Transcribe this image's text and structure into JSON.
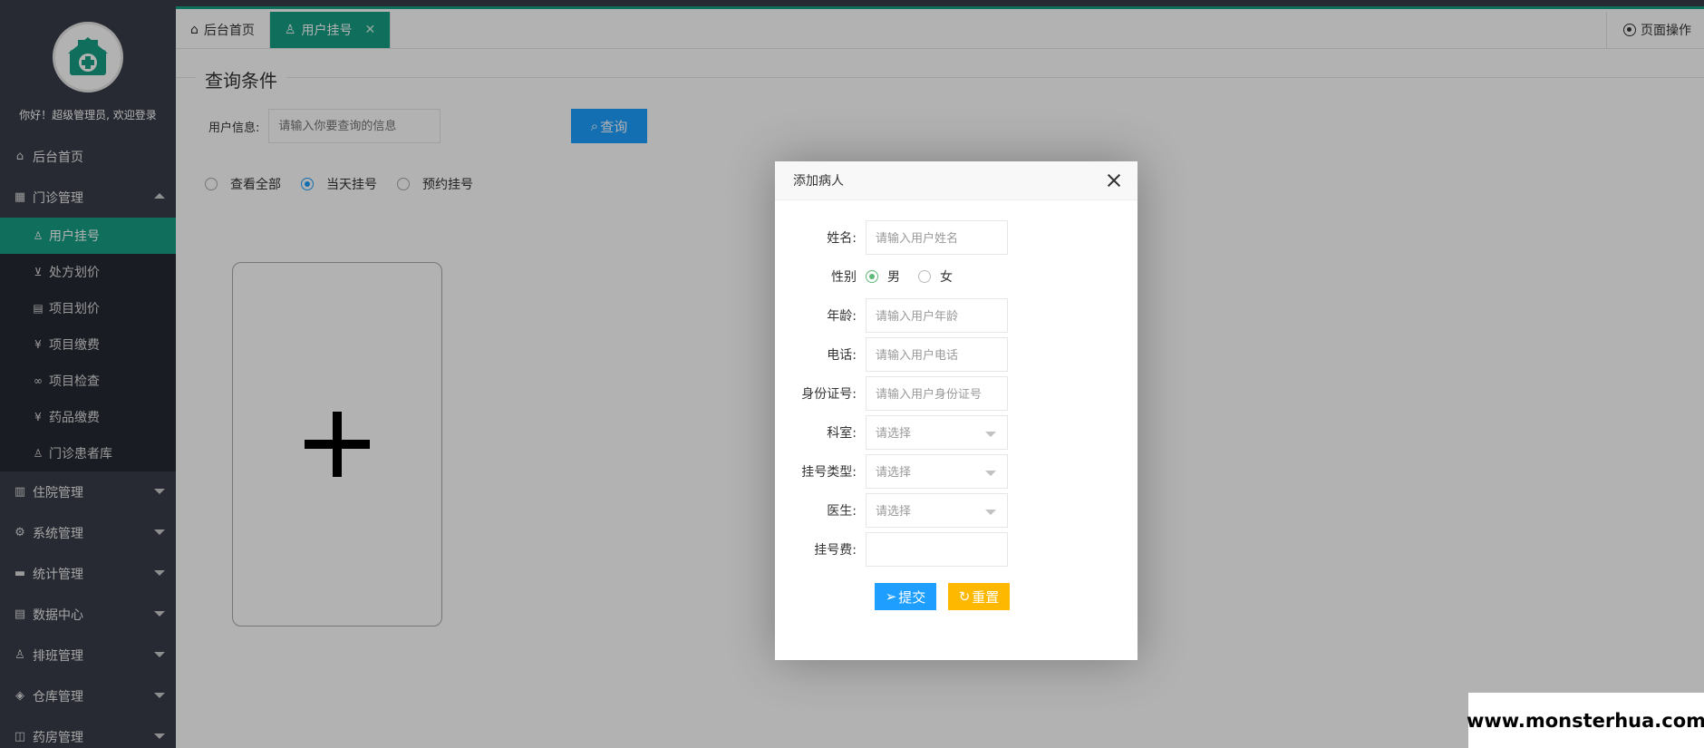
{
  "sidebar": {
    "welcome": "你好！超级管理员, 欢迎登录",
    "home": "后台首页",
    "outpatient": "门诊管理",
    "sub_items": [
      {
        "label": "用户挂号",
        "icon": "user-icon"
      },
      {
        "label": "处方划价",
        "icon": "cart-icon"
      },
      {
        "label": "项目划价",
        "icon": "document-icon"
      },
      {
        "label": "项目缴费",
        "icon": "yen-icon"
      },
      {
        "label": "项目检查",
        "icon": "link-icon"
      },
      {
        "label": "药品缴费",
        "icon": "yen-icon"
      },
      {
        "label": "门诊患者库",
        "icon": "person-icon"
      }
    ],
    "groups": [
      {
        "label": "住院管理",
        "icon": "building-icon"
      },
      {
        "label": "系统管理",
        "icon": "gear-icon"
      },
      {
        "label": "统计管理",
        "icon": "monitor-icon"
      },
      {
        "label": "数据中心",
        "icon": "document-icon"
      },
      {
        "label": "排班管理",
        "icon": "users-icon"
      },
      {
        "label": "仓库管理",
        "icon": "boxes-icon"
      },
      {
        "label": "药房管理",
        "icon": "pharmacy-icon"
      }
    ]
  },
  "tabs": {
    "home": "后台首页",
    "active": "用户挂号",
    "close": "✕",
    "page_ops": "页面操作"
  },
  "query": {
    "legend": "查询条件",
    "label": "用户信息:",
    "placeholder": "请输入你要查询的信息",
    "button": "查询",
    "filters": [
      "查看全部",
      "当天挂号",
      "预约挂号"
    ],
    "selected_filter": "当天挂号"
  },
  "modal": {
    "title": "添加病人",
    "fields": {
      "name_label": "姓名:",
      "name_placeholder": "请输入用户姓名",
      "gender_label": "性别",
      "gender_male": "男",
      "gender_female": "女",
      "age_label": "年龄:",
      "age_placeholder": "请输入用户年龄",
      "phone_label": "电话:",
      "phone_placeholder": "请输入用户电话",
      "id_label": "身份证号:",
      "id_placeholder": "请输入用户身份证号",
      "dept_label": "科室:",
      "dept_placeholder": "请选择",
      "regtype_label": "挂号类型:",
      "regtype_placeholder": "请选择",
      "doctor_label": "医生:",
      "doctor_placeholder": "请选择",
      "fee_label": "挂号费:",
      "fee_value": ""
    },
    "submit": "提交",
    "reset": "重置"
  },
  "watermark": "www.monsterhua.com",
  "colors": {
    "sidebar": "#393d49",
    "accent": "#16a085",
    "primary": "#1e9fff",
    "warning": "#ffb800"
  }
}
